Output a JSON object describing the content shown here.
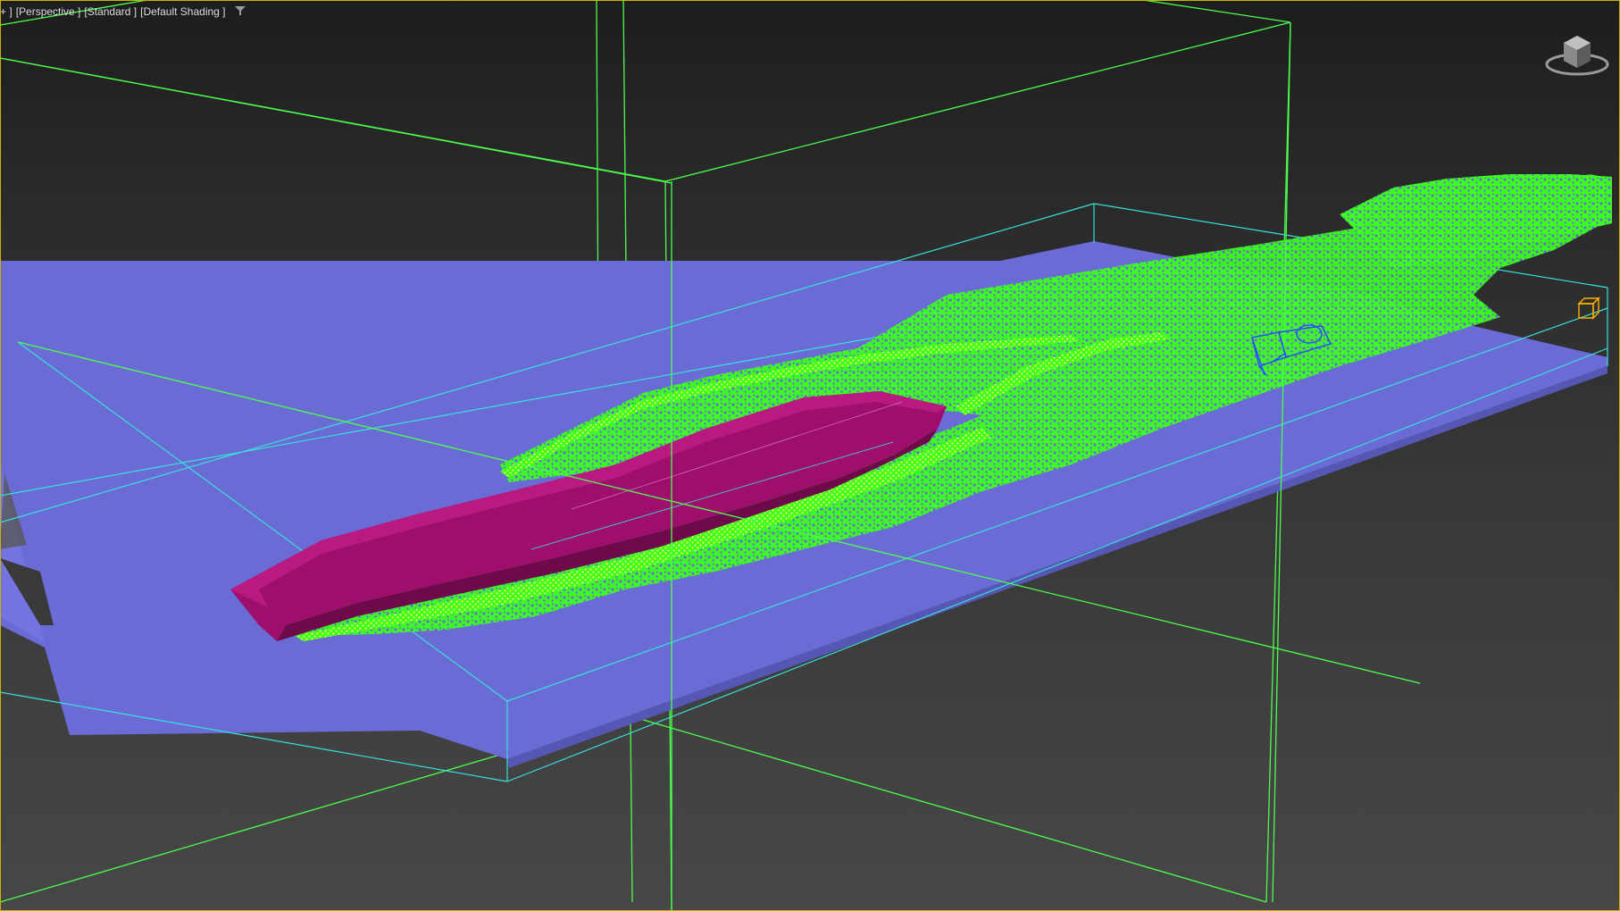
{
  "viewport": {
    "labels": {
      "menu_tail": "+ ]",
      "camera": "[Perspective ]",
      "render_mode": "[Standard ]",
      "shading": "[Default Shading ]"
    },
    "filter_icon": "funnel-icon",
    "viewcube_icon": "viewcube-icon",
    "colors": {
      "background_top": "#1d1d1d",
      "background_bottom": "#474747",
      "frame": "#c8b400",
      "grid_lines": "#4cff4c",
      "water_surface": "#6b6bd6",
      "hull": "#a0106e",
      "particles_primary": "#3cff1e",
      "particles_secondary": "#f0f040",
      "camera_gizmo": "#2b4cff",
      "selection_box": "#ffb000"
    }
  },
  "scene": {
    "objects": [
      "water-plane",
      "ship-hull",
      "foam-particles",
      "domain-box",
      "camera-gizmo"
    ]
  }
}
